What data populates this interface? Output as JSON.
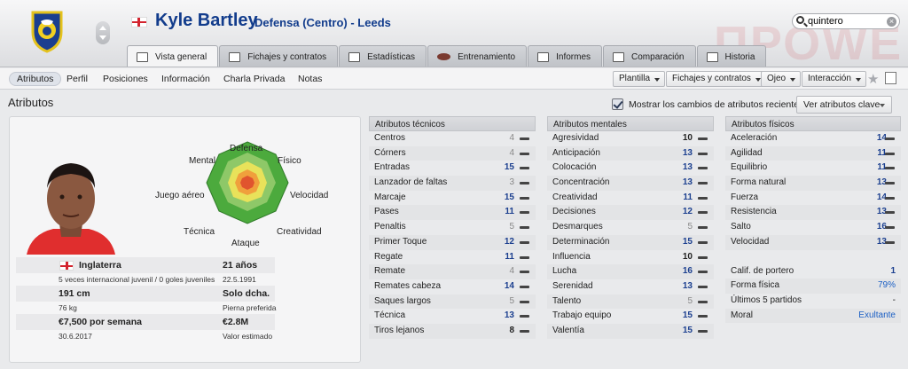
{
  "header": {
    "player_name": "Kyle Bartley",
    "subtitle": "Defensa (Centro) - Leeds",
    "watermark": "ПРОWE",
    "search_value": "quintero"
  },
  "tabs": [
    "Vista general",
    "Fichajes y contratos",
    "Estadísticas",
    "Entrenamiento",
    "Informes",
    "Comparación",
    "Historia"
  ],
  "subnav": {
    "items": [
      "Atributos",
      "Perfil",
      "Posiciones",
      "Información",
      "Charla Privada",
      "Notas"
    ],
    "dropdowns": [
      "Plantilla",
      "Fichajes y contratos",
      "Ojeo",
      "Interacción"
    ]
  },
  "section": {
    "title": "Atributos",
    "checkbox_label": "Mostrar los cambios de atributos recientes",
    "key_button": "Ver atributos clave"
  },
  "radar_labels": {
    "defensa": "Defensa",
    "mental": "Mental",
    "fisico": "Físico",
    "juego_aereo": "Juego aéreo",
    "velocidad": "Velocidad",
    "tecnica": "Técnica",
    "creatividad": "Creatividad",
    "ataque": "Ataque"
  },
  "info": {
    "nationality": "Inglaterra",
    "caps": "5 veces internacional juvenil / 0 goles juveniles",
    "age": "21 años",
    "dob": "22.5.1991",
    "height": "191 cm",
    "weight": "76 kg",
    "foot": "Solo dcha.",
    "foot_label": "Pierna preferida",
    "wage": "€7,500 por semana",
    "contract_end": "30.6.2017",
    "value": "€2.8M",
    "value_label": "Valor estimado"
  },
  "technical": {
    "title": "Atributos técnicos",
    "rows": [
      {
        "name": "Centros",
        "value": "4"
      },
      {
        "name": "Córners",
        "value": "4"
      },
      {
        "name": "Entradas",
        "value": "15"
      },
      {
        "name": "Lanzador de faltas",
        "value": "3"
      },
      {
        "name": "Marcaje",
        "value": "15"
      },
      {
        "name": "Pases",
        "value": "11"
      },
      {
        "name": "Penaltis",
        "value": "5"
      },
      {
        "name": "Primer Toque",
        "value": "12"
      },
      {
        "name": "Regate",
        "value": "11"
      },
      {
        "name": "Remate",
        "value": "4"
      },
      {
        "name": "Remates cabeza",
        "value": "14"
      },
      {
        "name": "Saques largos",
        "value": "5"
      },
      {
        "name": "Técnica",
        "value": "13"
      },
      {
        "name": "Tiros lejanos",
        "value": "8"
      }
    ]
  },
  "mental": {
    "title": "Atributos mentales",
    "rows": [
      {
        "name": "Agresividad",
        "value": "10"
      },
      {
        "name": "Anticipación",
        "value": "13"
      },
      {
        "name": "Colocación",
        "value": "13"
      },
      {
        "name": "Concentración",
        "value": "13"
      },
      {
        "name": "Creatividad",
        "value": "11"
      },
      {
        "name": "Decisiones",
        "value": "12"
      },
      {
        "name": "Desmarques",
        "value": "5"
      },
      {
        "name": "Determinación",
        "value": "15"
      },
      {
        "name": "Influencia",
        "value": "10"
      },
      {
        "name": "Lucha",
        "value": "16"
      },
      {
        "name": "Serenidad",
        "value": "13"
      },
      {
        "name": "Talento",
        "value": "5"
      },
      {
        "name": "Trabajo equipo",
        "value": "15"
      },
      {
        "name": "Valentía",
        "value": "15"
      }
    ]
  },
  "physical": {
    "title": "Atributos físicos",
    "rows": [
      {
        "name": "Aceleración",
        "value": "14"
      },
      {
        "name": "Agilidad",
        "value": "11"
      },
      {
        "name": "Equilibrio",
        "value": "11"
      },
      {
        "name": "Forma natural",
        "value": "13"
      },
      {
        "name": "Fuerza",
        "value": "14"
      },
      {
        "name": "Resistencia",
        "value": "13"
      },
      {
        "name": "Salto",
        "value": "16"
      },
      {
        "name": "Velocidad",
        "value": "13"
      }
    ]
  },
  "extra": {
    "rows": [
      {
        "name": "Calif. de portero",
        "value": "1"
      },
      {
        "name": "Forma física",
        "value": "79%"
      },
      {
        "name": "Últimos 5 partidos",
        "value": "-"
      },
      {
        "name": "Moral",
        "value": "Exultante"
      }
    ]
  },
  "colors": {
    "accent_blue": "#123c8c",
    "value_blue": "#1b3f8f",
    "radar_green": "#4caa3d",
    "radar_yellow": "#e8e25a",
    "radar_red": "#e0542e"
  }
}
